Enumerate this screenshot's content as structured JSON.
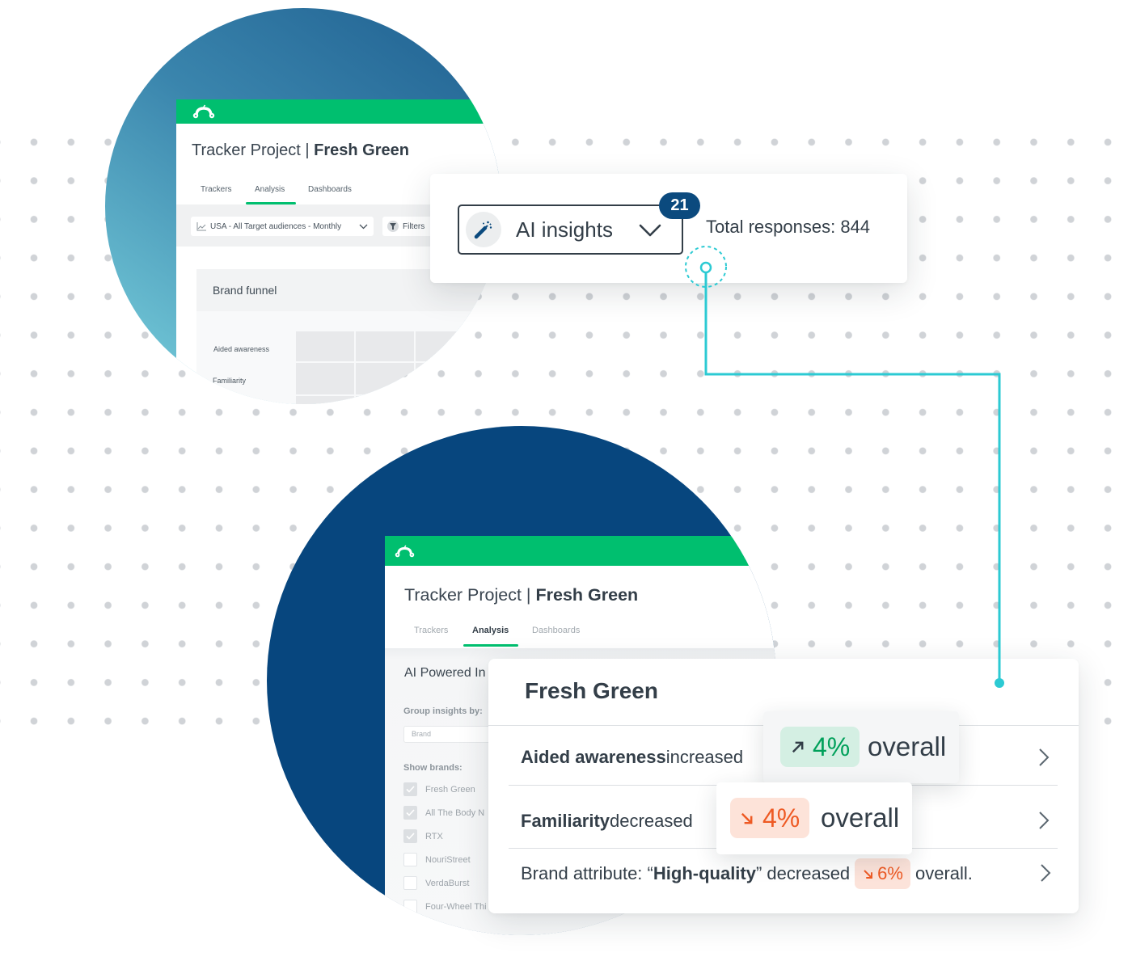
{
  "colors": {
    "brand_green": "#00bf6f",
    "navy": "#0b4a7e",
    "connector_cyan": "#2ccad3",
    "increase": "#00a05a",
    "decrease": "#ee5a24",
    "text": "#333e48"
  },
  "top_panel": {
    "title_prefix": "Tracker Project | ",
    "title_brand": "Fresh Green",
    "tabs": [
      {
        "label": "Trackers",
        "active": false
      },
      {
        "label": "Analysis",
        "active": true
      },
      {
        "label": "Dashboards",
        "active": false
      }
    ],
    "audience_select": "USA - All Target audiences - Monthly",
    "filters_label": "Filters",
    "brand_funnel": {
      "title": "Brand funnel",
      "rows": [
        "Aided awareness",
        "Familiarity"
      ]
    }
  },
  "ai_card": {
    "button_label": "AI insights",
    "button_icon": "magic-wand-icon",
    "badge_count": "21",
    "total_responses_label": "Total responses: ",
    "total_responses_value": "844"
  },
  "bottom_panel": {
    "title_prefix": "Tracker Project | ",
    "title_brand": "Fresh Green",
    "tabs": [
      {
        "label": "Trackers",
        "active": false
      },
      {
        "label": "Analysis",
        "active": true
      },
      {
        "label": "Dashboards",
        "active": false
      }
    ],
    "section_title": "AI Powered In",
    "group_by_label": "Group insights by:",
    "group_by_value": "Brand",
    "show_brands_label": "Show brands:",
    "brands": [
      {
        "name": "Fresh Green",
        "checked": true
      },
      {
        "name": "All The Body N",
        "checked": true
      },
      {
        "name": "RTX",
        "checked": true
      },
      {
        "name": "NouriStreet",
        "checked": false
      },
      {
        "name": "VerdaBurst",
        "checked": false
      },
      {
        "name": "Four-Wheel Thi",
        "checked": false
      }
    ]
  },
  "insights_card": {
    "title": "Fresh Green",
    "rows": [
      {
        "prefix": "",
        "metric": "Aided awareness",
        "verb": " increased",
        "direction": "up",
        "arrow": "arrow-up-right-icon",
        "change": "4%",
        "suffix": "overall"
      },
      {
        "prefix": "",
        "metric": "Familiarity",
        "verb": " decreased",
        "direction": "down",
        "arrow": "arrow-down-right-icon",
        "change": "4%",
        "suffix": "overall"
      },
      {
        "prefix": "Brand attribute: “",
        "metric": "High-quality",
        "verb": "” decreased",
        "direction": "down",
        "arrow": "arrow-down-right-icon",
        "change": "6%",
        "suffix": "overall."
      }
    ]
  }
}
